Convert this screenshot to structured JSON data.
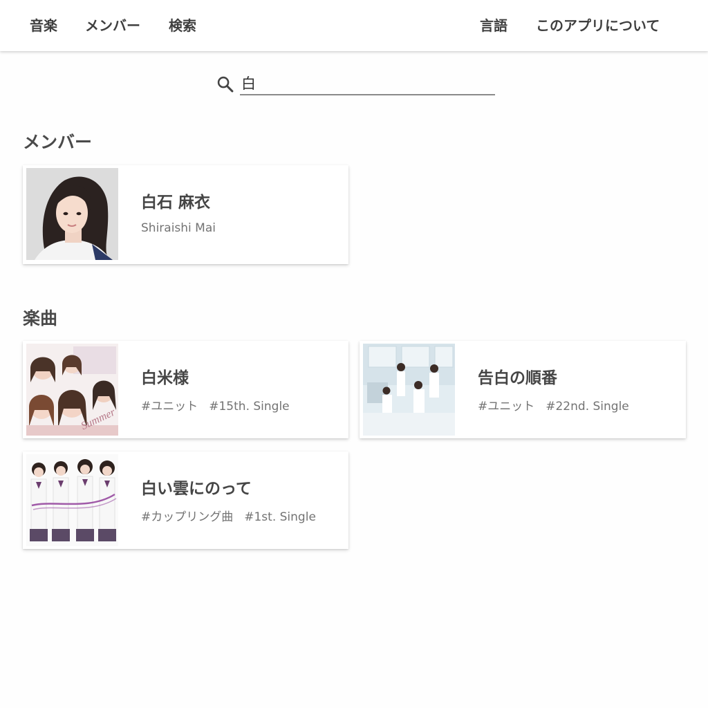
{
  "nav": {
    "left": [
      "音楽",
      "メンバー",
      "検索"
    ],
    "right": [
      "言語",
      "このアプリについて"
    ]
  },
  "search": {
    "value": "白",
    "icon": "search-icon"
  },
  "sections": {
    "members": {
      "title": "メンバー",
      "items": [
        {
          "name": "白石 麻衣",
          "romaji": "Shiraishi Mai"
        }
      ]
    },
    "songs": {
      "title": "楽曲",
      "items": [
        {
          "title": "白米様",
          "tags": [
            "#ユニット",
            "#15th. Single"
          ]
        },
        {
          "title": "告白の順番",
          "tags": [
            "#ユニット",
            "#22nd. Single"
          ]
        },
        {
          "title": "白い雲にのって",
          "tags": [
            "#カップリング曲",
            "#1st. Single"
          ]
        }
      ]
    }
  },
  "colors": {
    "accent": "#8e4fa0",
    "text": "#444444",
    "subtext": "#737373"
  }
}
